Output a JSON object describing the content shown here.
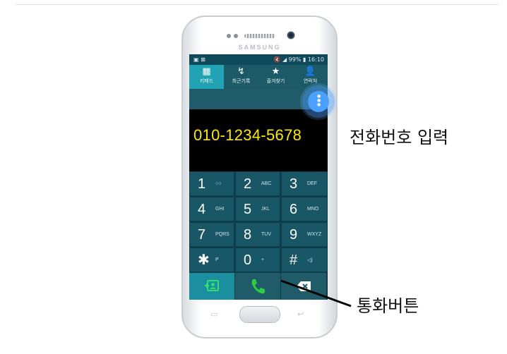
{
  "device": {
    "brand": "SAMSUNG"
  },
  "status_bar": {
    "left_icons": "▣ ⊠",
    "right_text": "🔇 ◢ 99% ▮ 16:10"
  },
  "tabs": [
    {
      "label": "키패드",
      "icon": "keypad-icon",
      "glyph": "▦",
      "active": true
    },
    {
      "label": "최근기록",
      "icon": "recent-calls-icon",
      "glyph": "↯",
      "active": false
    },
    {
      "label": "즐겨찾기",
      "icon": "star-icon",
      "glyph": "★",
      "active": false
    },
    {
      "label": "연락처",
      "icon": "person-icon",
      "glyph": "👤",
      "active": false
    }
  ],
  "dialer": {
    "number": "010-1234-5678"
  },
  "keys": [
    {
      "digit": "1",
      "sub": "○○"
    },
    {
      "digit": "2",
      "sub": "ABC"
    },
    {
      "digit": "3",
      "sub": "DEF"
    },
    {
      "digit": "4",
      "sub": "GHI"
    },
    {
      "digit": "5",
      "sub": "JKL"
    },
    {
      "digit": "6",
      "sub": "MNO"
    },
    {
      "digit": "7",
      "sub": "PQRS"
    },
    {
      "digit": "8",
      "sub": "TUV"
    },
    {
      "digit": "9",
      "sub": "WXYZ"
    },
    {
      "digit": "✱",
      "sub": "P"
    },
    {
      "digit": "0",
      "sub": "+"
    },
    {
      "digit": "#",
      "sub": "◁)"
    }
  ],
  "callouts": {
    "number_input": "전화번호 입력",
    "call_button": "통화버튼"
  },
  "softkeys": {
    "recent": "▭",
    "back": "↩"
  },
  "colors": {
    "accent": "#21a3b3",
    "number_text": "#ffe800",
    "call_green": "#2ecc40"
  }
}
